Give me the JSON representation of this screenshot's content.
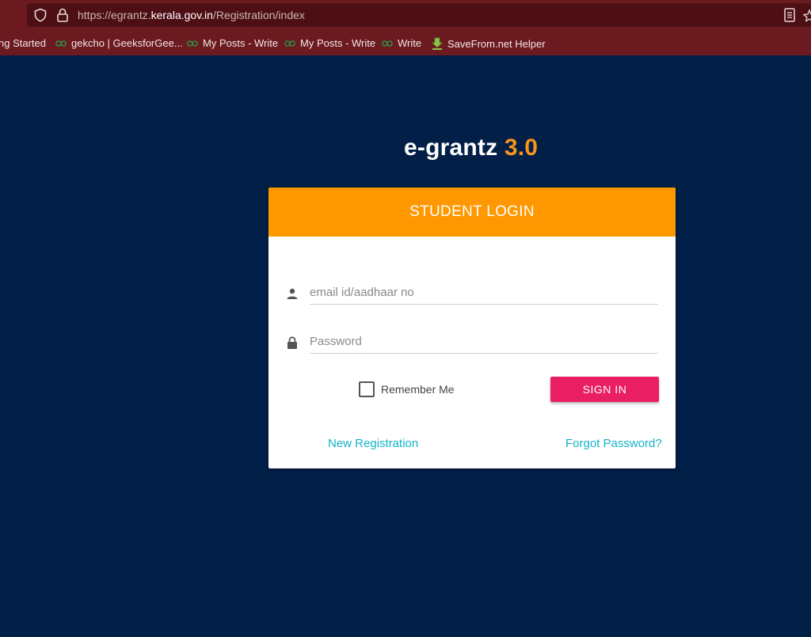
{
  "browser": {
    "url_prefix": "https://egrantz.",
    "url_domain": "kerala.gov.in",
    "url_path": "/Registration/index",
    "bookmarks": [
      {
        "label": "ng Started",
        "icon": "none"
      },
      {
        "label": "gekcho | GeeksforGee...",
        "icon": "geeksforgeeks-icon"
      },
      {
        "label": "My Posts - Write",
        "icon": "geeksforgeeks-icon"
      },
      {
        "label": "My Posts - Write",
        "icon": "geeksforgeeks-icon"
      },
      {
        "label": "Write",
        "icon": "geeksforgeeks-icon"
      },
      {
        "label": "SaveFrom.net Helper",
        "icon": "download-arrow-icon"
      }
    ]
  },
  "brand": {
    "name": "e-grantz",
    "version": "3.0"
  },
  "login": {
    "title": "STUDENT LOGIN",
    "username_placeholder": "email id/aadhaar no",
    "password_placeholder": "Password",
    "remember_label": "Remember Me",
    "signin_label": "SIGN IN",
    "new_registration": "New Registration",
    "forgot_password": "Forgot Password?"
  },
  "colors": {
    "background": "#021f48",
    "header_orange": "#ff9800",
    "version_orange": "#f7941d",
    "signin_pink": "#e91e63",
    "link_cyan": "#12b4c9",
    "browser_chrome": "#6b1a1f"
  }
}
